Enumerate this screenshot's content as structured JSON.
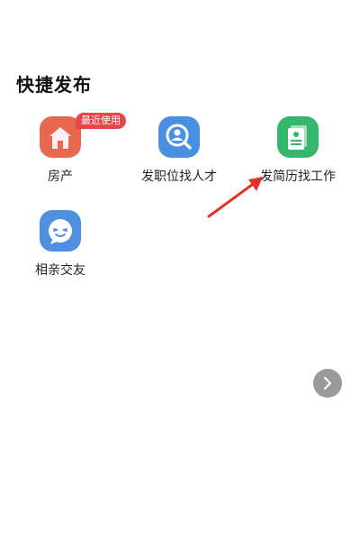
{
  "quick_post": {
    "title": "快捷发布",
    "items": [
      {
        "label": "房产",
        "icon": "house-icon",
        "color": "#e8674f",
        "badge": "最近使用"
      },
      {
        "label": "发职位找人才",
        "icon": "search-person-icon",
        "color": "#4a90e2"
      },
      {
        "label": "发简历找工作",
        "icon": "resume-icon",
        "color": "#35b66a"
      },
      {
        "label": "相亲交友",
        "icon": "chat-face-icon",
        "color": "#4f8fe0"
      }
    ]
  },
  "colors": {
    "badge": "#e8464a",
    "arrow": "#e0312b",
    "next_button": "#9a9a9a"
  },
  "pager": {
    "next_icon": "chevron-right-icon"
  }
}
